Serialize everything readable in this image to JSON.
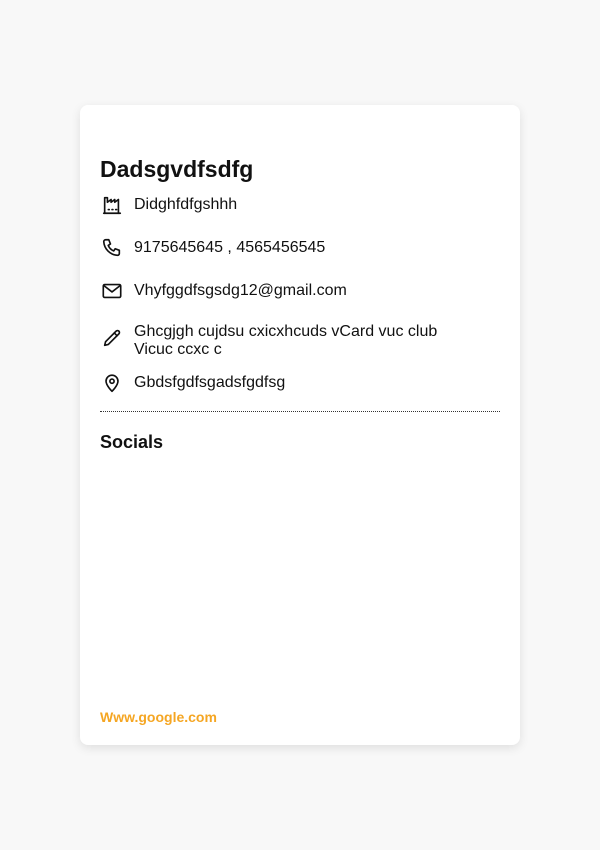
{
  "card": {
    "name": "Dadsgvdfsdfg",
    "company": "Didghfdfgshhh",
    "phones": "9175645645 , 4565456545",
    "email": "Vhyfggdfsgsdg12@gmail.com",
    "description": "Ghcgjgh cujdsu cxicxhcuds vCard vuc club Vicuc ccxc c",
    "address": "Gbdsfgdfsgadsfgdfsg",
    "socials_title": "Socials",
    "website": "Www.google.com"
  },
  "icons": {
    "company": "factory-icon",
    "phone": "phone-icon",
    "email": "mail-icon",
    "description": "pencil-icon",
    "address": "map-pin-icon"
  },
  "colors": {
    "page_background": "#f8f8f8",
    "card_background": "#ffffff",
    "text": "#111111",
    "website_link": "#f5a623"
  }
}
